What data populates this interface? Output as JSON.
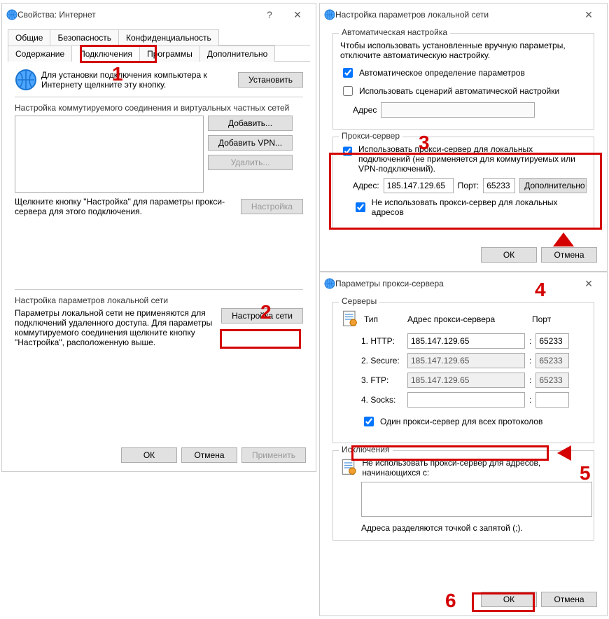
{
  "win1": {
    "title": "Свойства: Интернет",
    "help": "?",
    "close": "×",
    "tabs": [
      "Общие",
      "Безопасность",
      "Конфиденциальность",
      "Содержание",
      "Подключения",
      "Программы",
      "Дополнительно"
    ],
    "setup_text": "Для установки подключения компьютера к Интернету щелкните эту кнопку.",
    "setup_btn": "Установить",
    "dial_label": "Настройка коммутируемого соединения и виртуальных частных сетей",
    "add_btn": "Добавить...",
    "addvpn_btn": "Добавить VPN...",
    "del_btn": "Удалить...",
    "settings_btn": "Настройка",
    "dial_note": "Щелкните кнопку \"Настройка\" для параметры прокси-сервера для этого подключения.",
    "lan_label": "Настройка параметров локальной сети",
    "lan_note": "Параметры локальной сети не применяются для подключений удаленного доступа. Для параметры коммутируемого соединения щелкните кнопку \"Настройка\", расположенную выше.",
    "lan_btn": "Настройка сети",
    "ok": "ОК",
    "cancel": "Отмена",
    "apply": "Применить"
  },
  "win2": {
    "title": "Настройка параметров локальной сети",
    "close": "×",
    "auto_label": "Автоматическая настройка",
    "auto_note": "Чтобы использовать установленные вручную параметры, отключите автоматическую настройку.",
    "auto_detect": "Автоматическое определение параметров",
    "auto_script": "Использовать сценарий автоматической настройки",
    "addr_label": "Адрес",
    "proxy_label": "Прокси-сервер",
    "use_proxy": "Использовать прокси-сервер для локальных подключений (не применяется для коммутируемых или VPN-подключений).",
    "addr": "Адрес:",
    "addr_val": "185.147.129.65",
    "port": "Порт:",
    "port_val": "65233",
    "adv_btn": "Дополнительно",
    "bypass": "Не использовать прокси-сервер для локальных адресов",
    "ok": "ОК",
    "cancel": "Отмена"
  },
  "win3": {
    "title": "Параметры прокси-сервера",
    "close": "×",
    "servers": "Серверы",
    "type": "Тип",
    "addr_head": "Адрес прокси-сервера",
    "port_head": "Порт",
    "rows": [
      {
        "label": "1. HTTP:",
        "addr": "185.147.129.65",
        "port": "65233"
      },
      {
        "label": "2. Secure:",
        "addr": "185.147.129.65",
        "port": "65233"
      },
      {
        "label": "3. FTP:",
        "addr": "185.147.129.65",
        "port": "65233"
      },
      {
        "label": "4. Socks:",
        "addr": "",
        "port": ""
      }
    ],
    "same": "Один прокси-сервер для всех протоколов",
    "excl": "Исключения",
    "excl_note": "Не использовать прокси-сервер для адресов, начинающихся с:",
    "excl_hint": "Адреса разделяются точкой с запятой (;).",
    "ok": "ОК",
    "cancel": "Отмена"
  },
  "nums": {
    "1": "1",
    "2": "2",
    "3": "3",
    "4": "4",
    "5": "5",
    "6": "6"
  }
}
